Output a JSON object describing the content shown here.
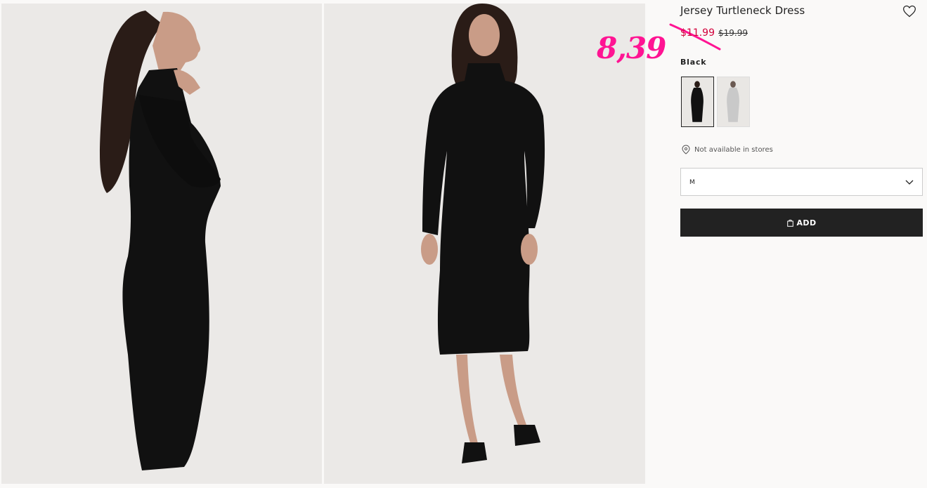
{
  "product": {
    "title": "Jersey Turtleneck Dress",
    "sale_price": "$11.99",
    "original_price": "$19.99",
    "color_label": "Black",
    "availability": "Not available in stores",
    "size_selected": "M",
    "add_label": "ADD"
  },
  "annotation": {
    "handwritten_price": "8,39"
  },
  "swatches": [
    {
      "color": "Black",
      "hex": "#111111",
      "selected": true
    },
    {
      "color": "Grey",
      "hex": "#c9c9c9",
      "selected": false
    }
  ],
  "colors": {
    "sale": "#d2003b",
    "annotation": "#ff1493",
    "button_bg": "#222222",
    "photo_bg": "#ebe9e7"
  }
}
